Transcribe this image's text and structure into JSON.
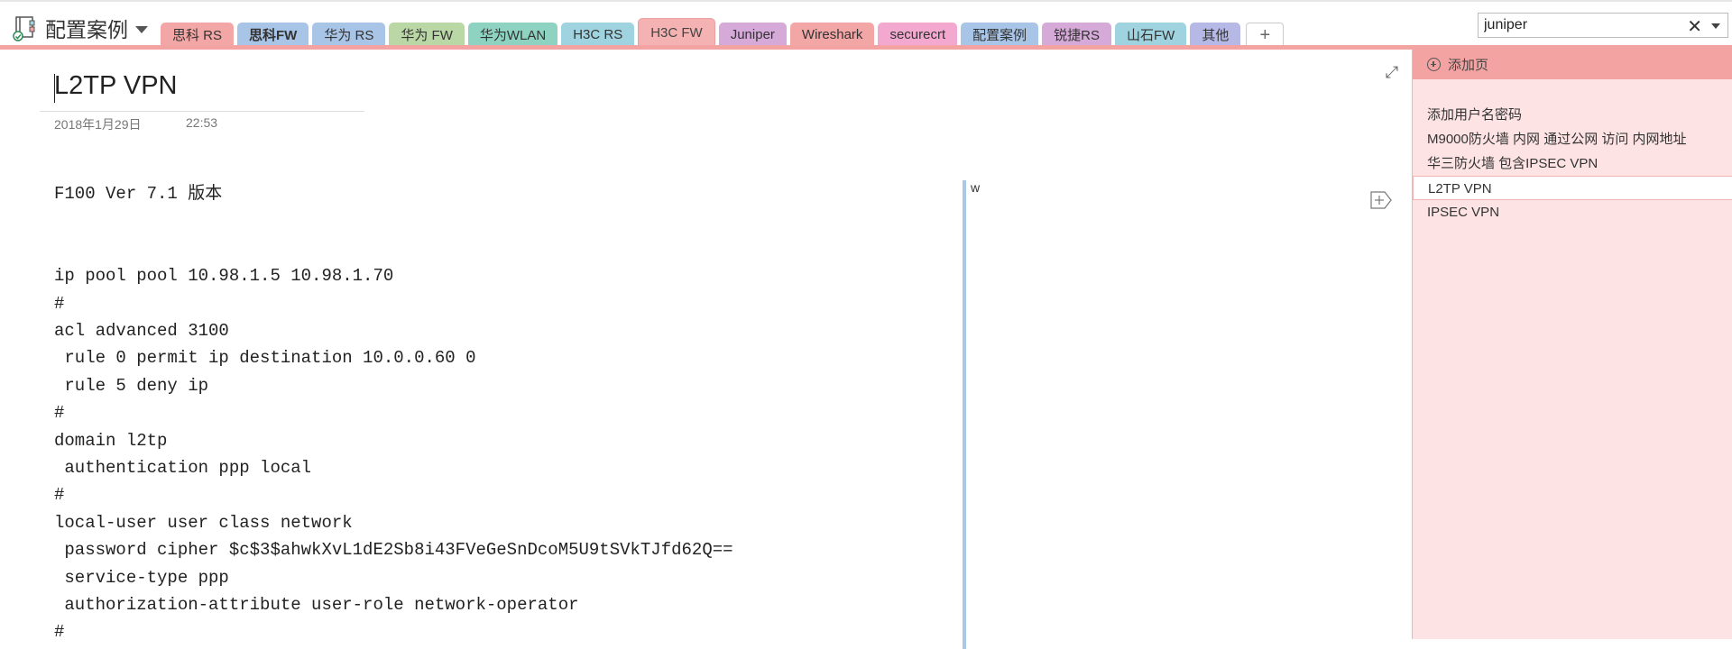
{
  "notebook": {
    "name": "配置案例"
  },
  "tabs": [
    {
      "label": "思科 RS",
      "color": "#f3a6a6",
      "bold": false,
      "active": false
    },
    {
      "label": "思科FW",
      "color": "#a8c4e6",
      "bold": true,
      "active": false
    },
    {
      "label": "华为 RS",
      "color": "#a8c4e6",
      "bold": false,
      "active": false
    },
    {
      "label": "华为 FW",
      "color": "#b9d8a6",
      "bold": false,
      "active": false
    },
    {
      "label": "华为WLAN",
      "color": "#8ed3c2",
      "bold": false,
      "active": false
    },
    {
      "label": "H3C RS",
      "color": "#9fd3df",
      "bold": false,
      "active": false
    },
    {
      "label": "H3C FW",
      "color": "#f4b2b2",
      "bold": false,
      "active": true
    },
    {
      "label": "Juniper",
      "color": "#d5a9d8",
      "bold": false,
      "active": false
    },
    {
      "label": "Wireshark",
      "color": "#f3a6a6",
      "bold": false,
      "active": false
    },
    {
      "label": "securecrt",
      "color": "#f3a9cf",
      "bold": false,
      "active": false
    },
    {
      "label": "配置案例",
      "color": "#a8c4e6",
      "bold": false,
      "active": false
    },
    {
      "label": "锐捷RS",
      "color": "#d5a9d8",
      "bold": false,
      "active": false
    },
    {
      "label": "山石FW",
      "color": "#9fd3df",
      "bold": false,
      "active": false
    },
    {
      "label": "其他",
      "color": "#b6b8e6",
      "bold": false,
      "active": false
    }
  ],
  "add_tab_label": "+",
  "search": {
    "value": "juniper",
    "clear_label": "✕"
  },
  "page": {
    "title": "L2TP VPN",
    "date": "2018年1月29日",
    "time": "22:53",
    "expand_icon": "⤢",
    "code_lines": [
      "F100 Ver 7.1 版本",
      "",
      "",
      "ip pool pool 10.98.1.5 10.98.1.70",
      "#",
      "acl advanced 3100",
      " rule 0 permit ip destination 10.0.0.60 0",
      " rule 5 deny ip",
      "#",
      "domain l2tp",
      " authentication ppp local",
      "#",
      "local-user user class network",
      " password cipher $c$3$ahwkXvL1dE2Sb8i43FVeGeSnDcoM5U9tSVkTJfd62Q==",
      " service-type ppp",
      " authorization-attribute user-role network-operator",
      "#"
    ],
    "side_note": "w"
  },
  "pages_panel": {
    "add_page_label": "添加页",
    "items": [
      {
        "label": "添加用户名密码",
        "selected": false
      },
      {
        "label": "M9000防火墙 内网  通过公网 访问  内网地址",
        "selected": false
      },
      {
        "label": "华三防火墙 包含IPSEC VPN",
        "selected": false
      },
      {
        "label": "L2TP VPN",
        "selected": true
      },
      {
        "label": "IPSEC VPN",
        "selected": false
      }
    ]
  },
  "colors": {
    "section_accent": "#f4a3a3",
    "panel_bg": "#fde3e3",
    "divider": "#a9c9e6"
  }
}
